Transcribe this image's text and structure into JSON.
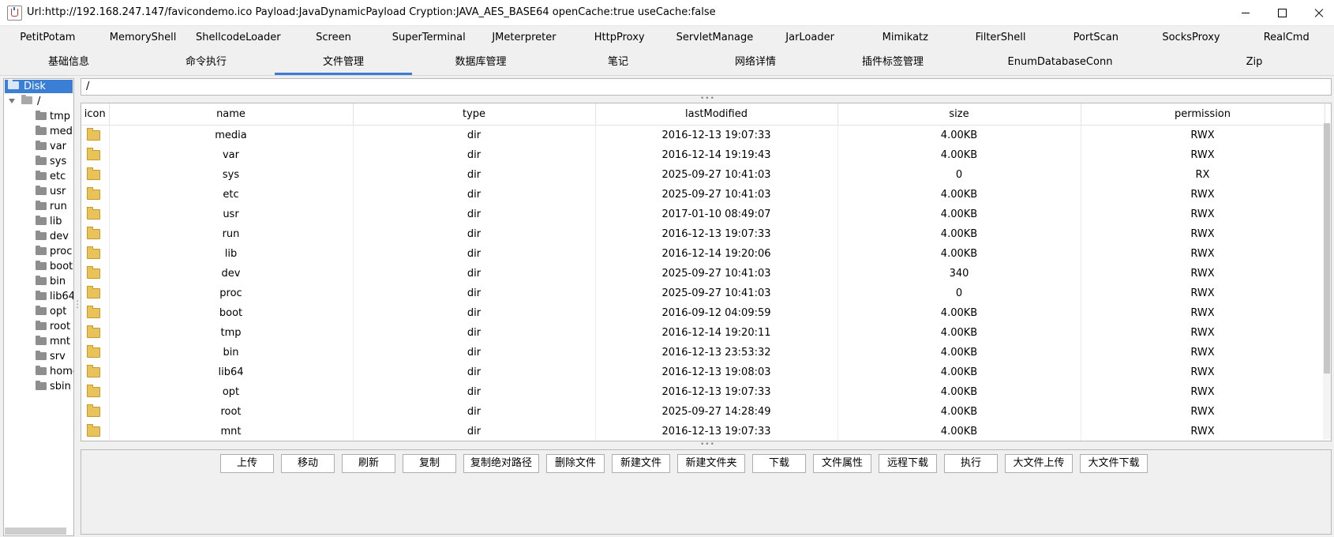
{
  "window": {
    "title": "Url:http://192.168.247.147/favicondemo.ico Payload:JavaDynamicPayload Cryption:JAVA_AES_BASE64 openCache:true useCache:false"
  },
  "plugin_tabs": [
    "PetitPotam",
    "MemoryShell",
    "ShellcodeLoader",
    "Screen",
    "SuperTerminal",
    "JMeterpreter",
    "HttpProxy",
    "ServletManage",
    "JarLoader",
    "Mimikatz",
    "FilterShell",
    "PortScan",
    "SocksProxy",
    "RealCmd"
  ],
  "main_tabs": [
    "基础信息",
    "命令执行",
    "文件管理",
    "数据库管理",
    "笔记",
    "网络详情",
    "插件标签管理",
    "EnumDatabaseConn",
    "Zip"
  ],
  "active_main_tab": "文件管理",
  "tree": {
    "root_label": "Disk",
    "path_label": "/",
    "items": [
      "tmp",
      "medi",
      "var",
      "sys",
      "etc",
      "usr",
      "run",
      "lib",
      "dev",
      "proc",
      "boot",
      "bin",
      "lib64",
      "opt",
      "root",
      "mnt",
      "srv",
      "home",
      "sbin"
    ]
  },
  "path_field": {
    "value": "/"
  },
  "table": {
    "columns": [
      "icon",
      "name",
      "type",
      "lastModified",
      "size",
      "permission"
    ],
    "rows": [
      {
        "name": "media",
        "type": "dir",
        "lastModified": "2016-12-13 19:07:33",
        "size": "4.00KB",
        "permission": "RWX"
      },
      {
        "name": "var",
        "type": "dir",
        "lastModified": "2016-12-14 19:19:43",
        "size": "4.00KB",
        "permission": "RWX"
      },
      {
        "name": "sys",
        "type": "dir",
        "lastModified": "2025-09-27 10:41:03",
        "size": "0",
        "permission": "RX"
      },
      {
        "name": "etc",
        "type": "dir",
        "lastModified": "2025-09-27 10:41:03",
        "size": "4.00KB",
        "permission": "RWX"
      },
      {
        "name": "usr",
        "type": "dir",
        "lastModified": "2017-01-10 08:49:07",
        "size": "4.00KB",
        "permission": "RWX"
      },
      {
        "name": "run",
        "type": "dir",
        "lastModified": "2016-12-13 19:07:33",
        "size": "4.00KB",
        "permission": "RWX"
      },
      {
        "name": "lib",
        "type": "dir",
        "lastModified": "2016-12-14 19:20:06",
        "size": "4.00KB",
        "permission": "RWX"
      },
      {
        "name": "dev",
        "type": "dir",
        "lastModified": "2025-09-27 10:41:03",
        "size": "340",
        "permission": "RWX"
      },
      {
        "name": "proc",
        "type": "dir",
        "lastModified": "2025-09-27 10:41:03",
        "size": "0",
        "permission": "RWX"
      },
      {
        "name": "boot",
        "type": "dir",
        "lastModified": "2016-09-12 04:09:59",
        "size": "4.00KB",
        "permission": "RWX"
      },
      {
        "name": "tmp",
        "type": "dir",
        "lastModified": "2016-12-14 19:20:11",
        "size": "4.00KB",
        "permission": "RWX"
      },
      {
        "name": "bin",
        "type": "dir",
        "lastModified": "2016-12-13 23:53:32",
        "size": "4.00KB",
        "permission": "RWX"
      },
      {
        "name": "lib64",
        "type": "dir",
        "lastModified": "2016-12-13 19:08:03",
        "size": "4.00KB",
        "permission": "RWX"
      },
      {
        "name": "opt",
        "type": "dir",
        "lastModified": "2016-12-13 19:07:33",
        "size": "4.00KB",
        "permission": "RWX"
      },
      {
        "name": "root",
        "type": "dir",
        "lastModified": "2025-09-27 14:28:49",
        "size": "4.00KB",
        "permission": "RWX"
      },
      {
        "name": "mnt",
        "type": "dir",
        "lastModified": "2016-12-13 19:07:33",
        "size": "4.00KB",
        "permission": "RWX"
      }
    ]
  },
  "actions": [
    "上传",
    "移动",
    "刷新",
    "复制",
    "复制绝对路径",
    "删除文件",
    "新建文件",
    "新建文件夹",
    "下载",
    "文件属性",
    "远程下载",
    "执行",
    "大文件上传",
    "大文件下载"
  ],
  "colors": {
    "selection": "#3a7fd5",
    "active_tab_underline": "#3b7bd4",
    "folder": "#e8c35a"
  }
}
